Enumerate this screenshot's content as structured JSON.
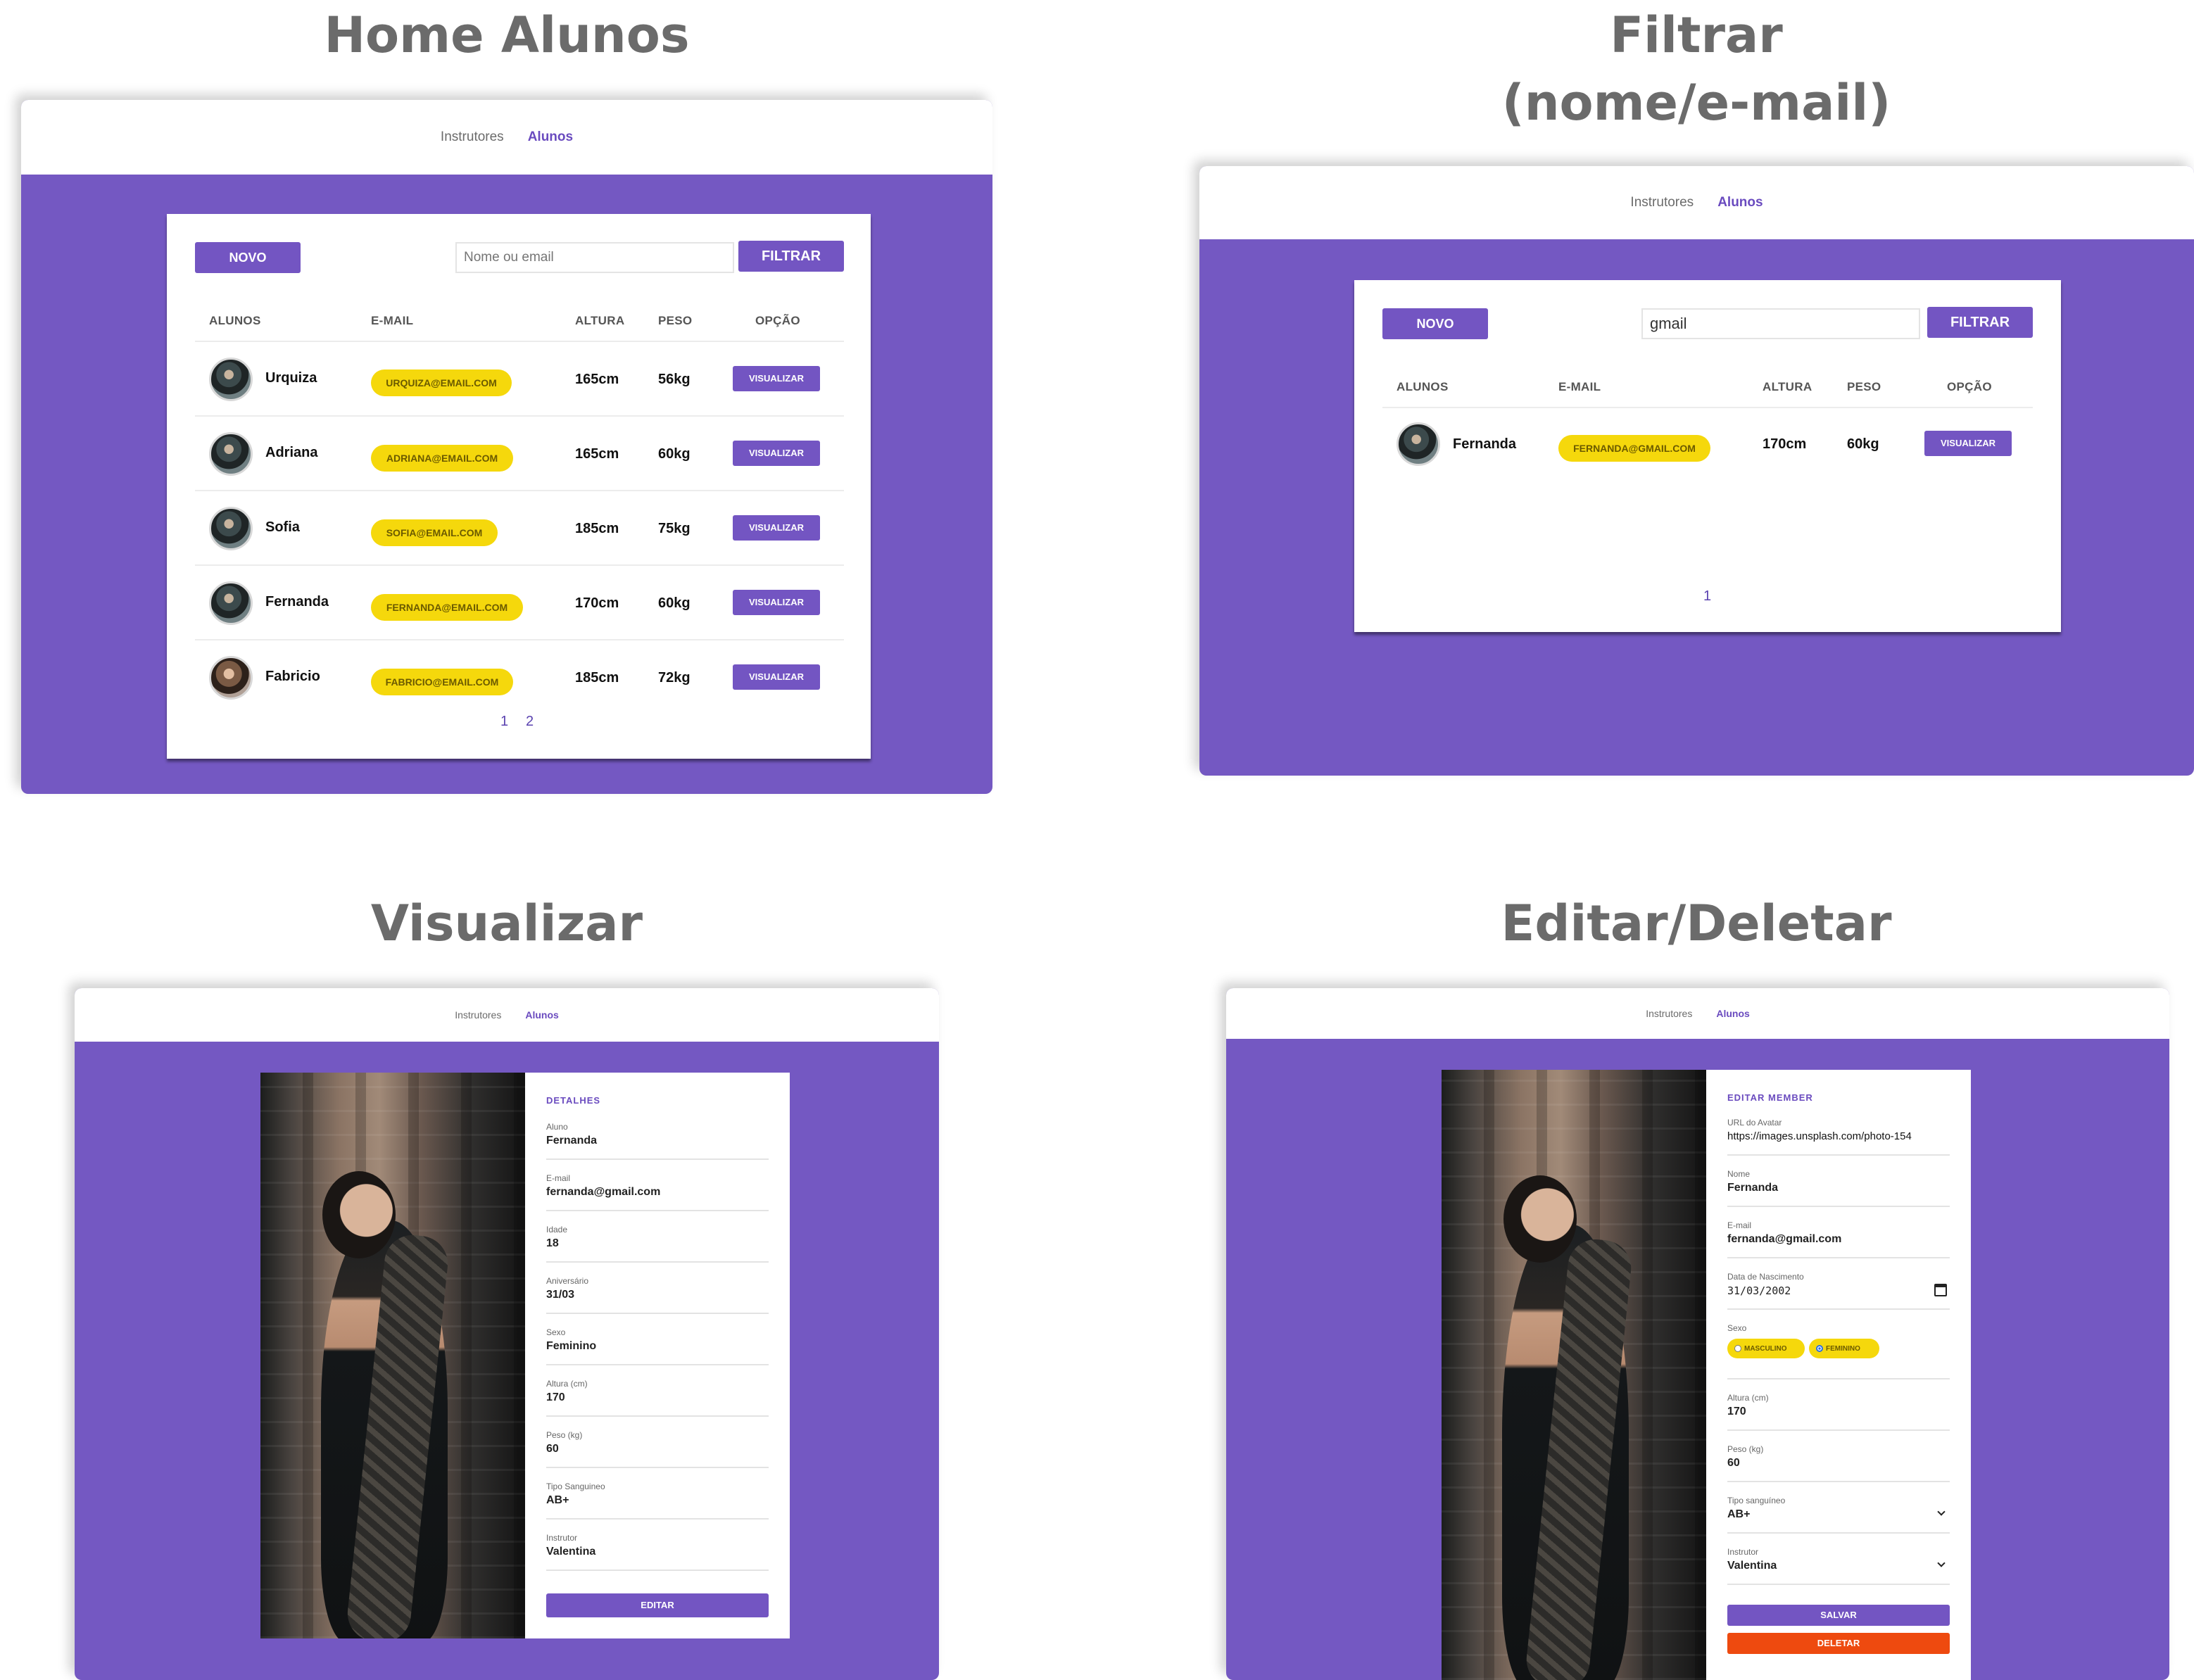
{
  "panels": {
    "home": {
      "title": "Home Alunos",
      "nav": {
        "instrutores": "Instrutores",
        "alunos": "Alunos"
      },
      "novo_label": "NOVO",
      "search_placeholder": "Nome ou email",
      "filtrar_label": "FILTRAR",
      "headers": {
        "alunos": "ALUNOS",
        "email": "E-MAIL",
        "altura": "ALTURA",
        "peso": "PESO",
        "opcao": "OPÇÃO"
      },
      "rows": [
        {
          "name": "Urquiza",
          "email": "URQUIZA@EMAIL.COM",
          "altura": "165cm",
          "peso": "56kg",
          "action": "VISUALIZAR"
        },
        {
          "name": "Adriana",
          "email": "ADRIANA@EMAIL.COM",
          "altura": "165cm",
          "peso": "60kg",
          "action": "VISUALIZAR"
        },
        {
          "name": "Sofia",
          "email": "SOFIA@EMAIL.COM",
          "altura": "185cm",
          "peso": "75kg",
          "action": "VISUALIZAR"
        },
        {
          "name": "Fernanda",
          "email": "FERNANDA@EMAIL.COM",
          "altura": "170cm",
          "peso": "60kg",
          "action": "VISUALIZAR"
        },
        {
          "name": "Fabricio",
          "email": "FABRICIO@EMAIL.COM",
          "altura": "185cm",
          "peso": "72kg",
          "action": "VISUALIZAR"
        }
      ],
      "pages": [
        "1",
        "2"
      ]
    },
    "filtrar": {
      "title_line1": "Filtrar",
      "title_line2": "(nome/e-mail)",
      "nav": {
        "instrutores": "Instrutores",
        "alunos": "Alunos"
      },
      "novo_label": "NOVO",
      "search_value": "gmail",
      "filtrar_label": "FILTRAR",
      "headers": {
        "alunos": "ALUNOS",
        "email": "E-MAIL",
        "altura": "ALTURA",
        "peso": "PESO",
        "opcao": "OPÇÃO"
      },
      "rows": [
        {
          "name": "Fernanda",
          "email": "FERNANDA@GMAIL.COM",
          "altura": "170cm",
          "peso": "60kg",
          "action": "VISUALIZAR"
        }
      ],
      "pages": [
        "1"
      ]
    },
    "visualizar": {
      "title": "Visualizar",
      "nav": {
        "instrutores": "Instrutores",
        "alunos": "Alunos"
      },
      "section": "DETALHES",
      "fields": [
        {
          "label": "Aluno",
          "value": "Fernanda"
        },
        {
          "label": "E-mail",
          "value": "fernanda@gmail.com"
        },
        {
          "label": "Idade",
          "value": "18"
        },
        {
          "label": "Aniversário",
          "value": "31/03"
        },
        {
          "label": "Sexo",
          "value": "Feminino"
        },
        {
          "label": "Altura (cm)",
          "value": "170"
        },
        {
          "label": "Peso (kg)",
          "value": "60"
        },
        {
          "label": "Tipo Sanguineo",
          "value": "AB+"
        },
        {
          "label": "Instrutor",
          "value": "Valentina"
        }
      ],
      "editar_label": "EDITAR"
    },
    "editar": {
      "title": "Editar/Deletar",
      "nav": {
        "instrutores": "Instrutores",
        "alunos": "Alunos"
      },
      "section": "EDITAR MEMBER",
      "avatar_label": "URL do Avatar",
      "avatar_value": "https://images.unsplash.com/photo-154",
      "nome_label": "Nome",
      "nome_value": "Fernanda",
      "email_label": "E-mail",
      "email_value": "fernanda@gmail.com",
      "nasc_label": "Data de Nascimento",
      "nasc_value": "31/03/2002",
      "sexo_label": "Sexo",
      "sexo_options": [
        "MASCULINO",
        "FEMININO"
      ],
      "sexo_selected": "FEMININO",
      "altura_label": "Altura (cm)",
      "altura_value": "170",
      "peso_label": "Peso (kg)",
      "peso_value": "60",
      "tipo_label": "Tipo sanguíneo",
      "tipo_value": "AB+",
      "instrutor_label": "Instrutor",
      "instrutor_value": "Valentina",
      "salvar_label": "SALVAR",
      "deletar_label": "DELETAR"
    }
  },
  "colors": {
    "primary": "#7458c2",
    "accent": "#f5d80c",
    "danger": "#ee4a0f"
  }
}
